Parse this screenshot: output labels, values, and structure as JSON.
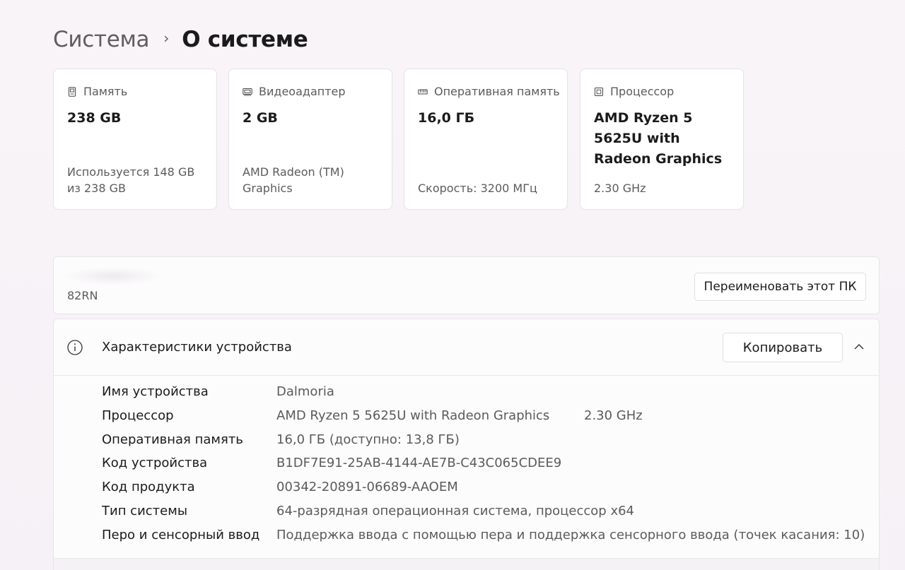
{
  "breadcrumb": {
    "parent": "Система",
    "separator": "›",
    "current": "О системе"
  },
  "cards": [
    {
      "icon": "storage-icon",
      "title": "Память",
      "value": "238 GB",
      "sub": "Используется 148 GB из 238 GB"
    },
    {
      "icon": "gpu-icon",
      "title": "Видеоадаптер",
      "value": "2 GB",
      "sub": "AMD Radeon (TM) Graphics"
    },
    {
      "icon": "ram-icon",
      "title": "Оперативная память",
      "value": "16,0 ГБ",
      "sub": "Скорость: 3200 МГц"
    },
    {
      "icon": "cpu-icon",
      "title": "Процессор",
      "value": "AMD Ryzen 5 5625U with Radeon Graphics",
      "sub": "2.30 GHz"
    }
  ],
  "pc": {
    "model": "82RN",
    "rename_label": "Переименовать этот ПК"
  },
  "specs": {
    "title": "Характеристики устройства",
    "copy_label": "Копировать",
    "rows": [
      {
        "label": "Имя устройства",
        "value": "Dalmoria",
        "extra": ""
      },
      {
        "label": "Процессор",
        "value": "AMD Ryzen 5 5625U with Radeon Graphics",
        "extra": "2.30 GHz"
      },
      {
        "label": "Оперативная память",
        "value": "16,0 ГБ (доступно: 13,8 ГБ)",
        "extra": ""
      },
      {
        "label": "Код устройства",
        "value": "B1DF7E91-25AB-4144-AE7B-C43C065CDEE9",
        "extra": ""
      },
      {
        "label": "Код продукта",
        "value": "00342-20891-06689-AAOEM",
        "extra": ""
      },
      {
        "label": "Тип системы",
        "value": "64-разрядная операционная система, процессор x64",
        "extra": ""
      },
      {
        "label": "Перо и сенсорный ввод",
        "value": "Поддержка ввода с помощью пера и поддержка сенсорного ввода (точек касания: 10)",
        "extra": ""
      }
    ]
  }
}
